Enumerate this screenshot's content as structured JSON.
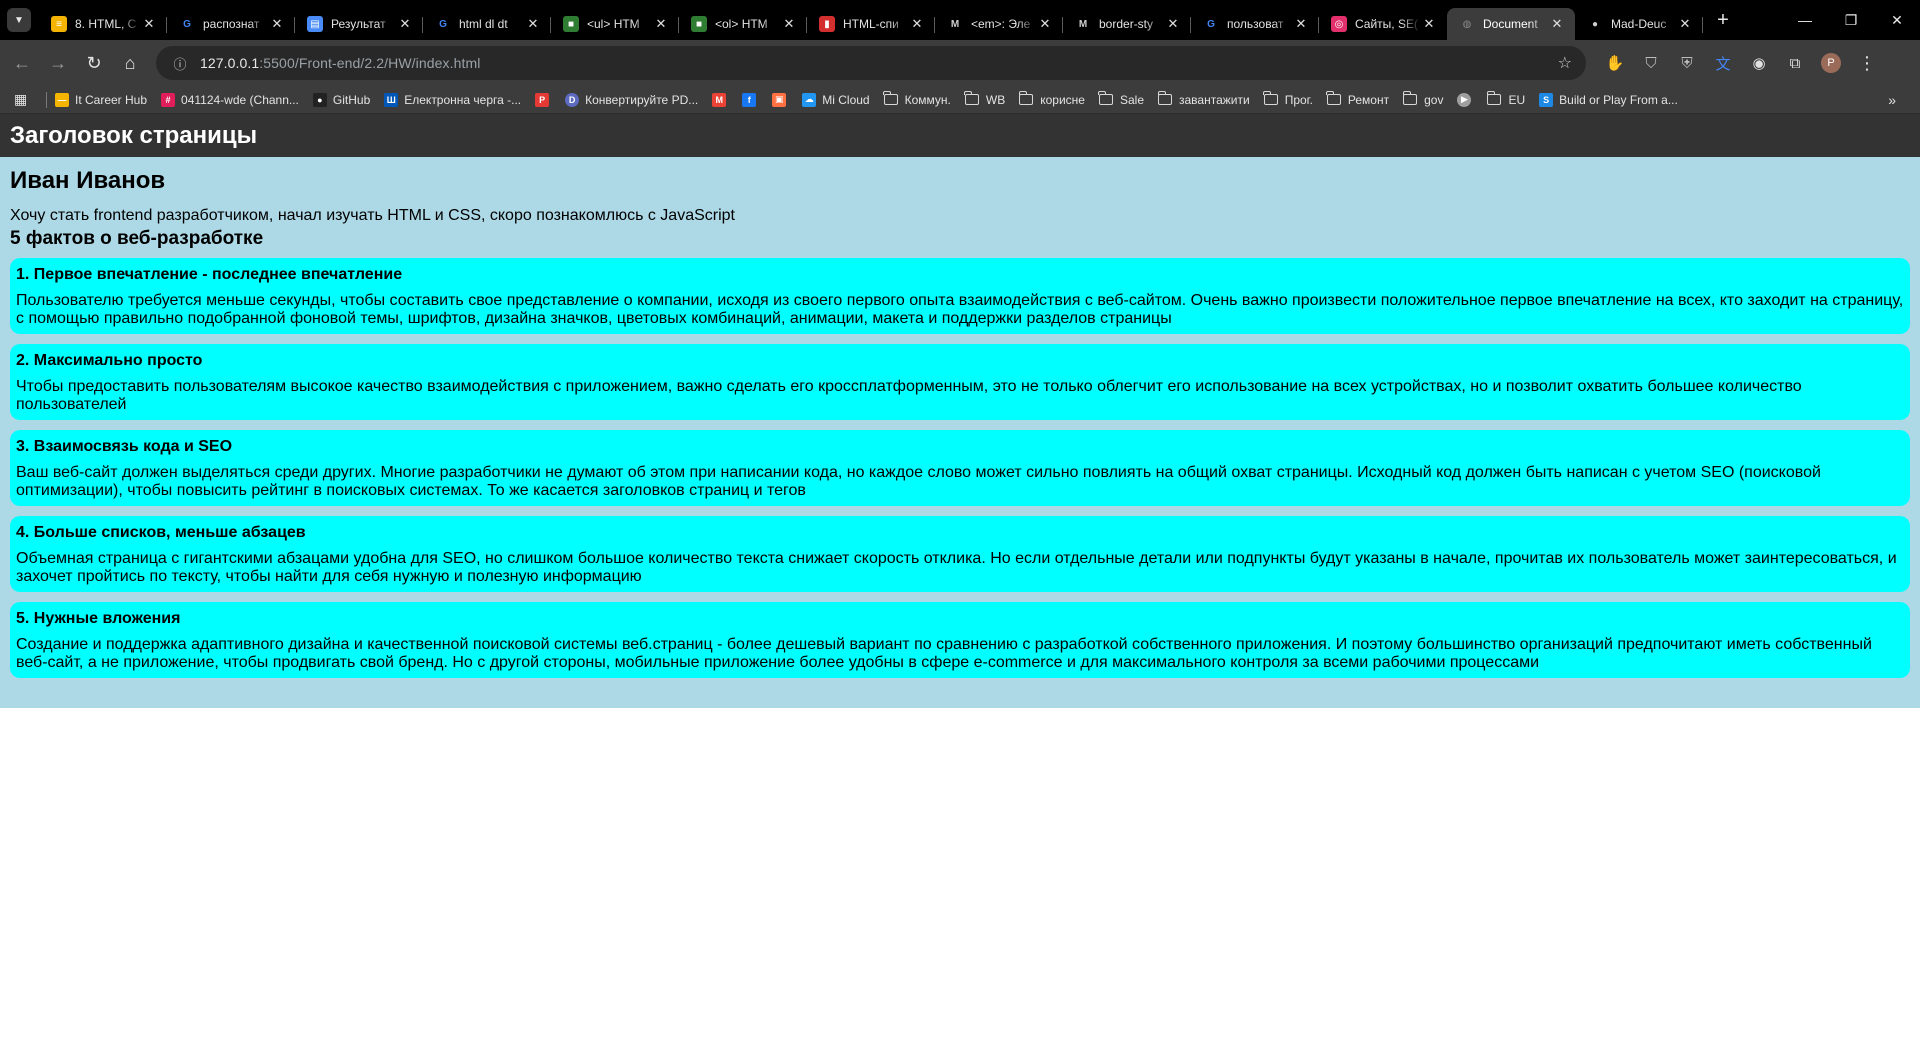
{
  "browser": {
    "tabs": [
      {
        "title": "8. HTML, С",
        "icon": "ui-lines-icon",
        "color": "#f4b400"
      },
      {
        "title": "распознат",
        "icon": "google-g-icon",
        "color": "#4285f4"
      },
      {
        "title": "Результат",
        "icon": "document-icon",
        "color": "#4a8cf7"
      },
      {
        "title": "html dl dt",
        "icon": "google-g-icon",
        "color": "#4285f4"
      },
      {
        "title": "<ul> HTM",
        "icon": "mdn-grid-icon",
        "color": "#2e7d32"
      },
      {
        "title": "<ol> HTM",
        "icon": "mdn-grid-icon",
        "color": "#2e7d32"
      },
      {
        "title": "HTML-спи",
        "icon": "chart-bars-icon",
        "color": "#d32f2f"
      },
      {
        "title": "<em>: Эле",
        "icon": "mdn-m-icon",
        "color": "#cfcfcf"
      },
      {
        "title": "border-sty",
        "icon": "mdn-m-icon",
        "color": "#cfcfcf"
      },
      {
        "title": "пользоват",
        "icon": "google-g-icon",
        "color": "#4285f4"
      },
      {
        "title": "Сайты, SE(",
        "icon": "instagram-icon",
        "color": "#e1306c"
      },
      {
        "title": "Document",
        "icon": "globe-icon",
        "color": "#8a8a8a"
      },
      {
        "title": "Mad-Deuc",
        "icon": "github-icon",
        "color": "#cfcfcf"
      }
    ],
    "active_tab_index": 11,
    "url_host": "127.0.0.1",
    "url_path": ":5500/Front-end/2.2/HW/index.html",
    "bookmarks": [
      {
        "label": "It Career Hub",
        "type": "link",
        "icon": "itcareer-icon",
        "color": "#f4b400"
      },
      {
        "label": "041124-wde (Chann...",
        "type": "link",
        "icon": "slack-icon",
        "color": "#e01e5a"
      },
      {
        "label": "GitHub",
        "type": "link",
        "icon": "github-icon",
        "color": "#222222"
      },
      {
        "label": "Електронна черга -...",
        "type": "link",
        "icon": "trident-icon",
        "color": "#0057b7"
      },
      {
        "label": "",
        "type": "icon",
        "icon": "pdf-icon",
        "color": "#e53935"
      },
      {
        "label": "Конвертируйте PD...",
        "type": "link",
        "icon": "d-circle-icon",
        "color": "#5c6bc0"
      },
      {
        "label": "",
        "type": "icon",
        "icon": "gmail-icon",
        "color": "#ea4335"
      },
      {
        "label": "",
        "type": "icon",
        "icon": "facebook-icon",
        "color": "#1877f2"
      },
      {
        "label": "",
        "type": "icon",
        "icon": "bookmark-app-icon",
        "color": "#ff7043"
      },
      {
        "label": "Mi Cloud",
        "type": "link",
        "icon": "cloud-icon",
        "color": "#2196f3"
      },
      {
        "label": "Коммун.",
        "type": "folder",
        "icon": "folder-icon"
      },
      {
        "label": "WB",
        "type": "folder",
        "icon": "folder-icon"
      },
      {
        "label": "корисне",
        "type": "folder",
        "icon": "folder-icon"
      },
      {
        "label": "Sale",
        "type": "folder",
        "icon": "folder-icon"
      },
      {
        "label": "завантажити",
        "type": "folder",
        "icon": "folder-icon"
      },
      {
        "label": "Прог.",
        "type": "folder",
        "icon": "folder-icon"
      },
      {
        "label": "Ремонт",
        "type": "folder",
        "icon": "folder-icon"
      },
      {
        "label": "gov",
        "type": "folder",
        "icon": "folder-icon"
      },
      {
        "label": "",
        "type": "icon",
        "icon": "play-circle-icon",
        "color": "#9e9e9e"
      },
      {
        "label": "EU",
        "type": "folder",
        "icon": "folder-icon"
      },
      {
        "label": "Build or Play From a...",
        "type": "link",
        "icon": "s-logo-icon",
        "color": "#1e88e5"
      }
    ],
    "extensions": [
      {
        "icon": "adblock-hand-icon",
        "color": "#e53935"
      },
      {
        "icon": "shield-icon",
        "color": "#bdbdbd"
      },
      {
        "icon": "shield-check-icon",
        "color": "#bdbdbd"
      },
      {
        "icon": "translate-icon",
        "color": "#4285f4"
      },
      {
        "icon": "screenshot-icon",
        "color": "#e0e0e0"
      },
      {
        "icon": "puzzle-icon",
        "color": "#e0e0e0"
      }
    ],
    "avatar_letter": "P"
  },
  "page": {
    "header_title": "Заголовок страницы",
    "name": "Иван Иванов",
    "intro": "Хочу стать frontend разработчиком, начал изучать HTML и CSS, скоро познакомлюсь с JavaScript",
    "facts_title": "5 фактов о веб-разработке",
    "facts": [
      {
        "title": "1. Первое впечатление - последнее впечатление",
        "text": "Пользователю требуется меньше секунды, чтобы составить свое представление о компании, исходя из своего первого опыта взаимодействия с веб-сайтом. Очень важно произвести положительное первое впечатление на всех, кто заходит на страницу, с помощью правильно подобранной фоновой темы, шрифтов, дизайна значков, цветовых комбинаций, анимации, макета и поддержки разделов страницы"
      },
      {
        "title": "2. Максимально просто",
        "text": "Чтобы предоставить пользователям высокое качество взаимодействия с приложением, важно сделать его кроссплатформенным, это не только облегчит его использование на всех устройствах, но и позволит охватить большее количество пользователей"
      },
      {
        "title": "3. Взаимосвязь кода и SEO",
        "text": "Ваш веб-сайт должен выделяться среди других. Многие разработчики не думают об этом при написании кода, но каждое слово может сильно повлиять на общий охват страницы. Исходный код должен быть написан с учетом SEO (поисковой оптимизации), чтобы повысить рейтинг в поисковых системах. То же касается заголовков страниц и тегов"
      },
      {
        "title": "4. Больше списков, меньше абзацев",
        "text": "Объемная страница с гигантскими абзацами удобна для SEO, но слишком большое количество текста снижает скорость отклика. Но если отдельные детали или подпункты будут указаны в начале, прочитав их пользователь может заинтересоваться, и захочет пройтись по тексту, чтобы найти для себя нужную и полезную информацию"
      },
      {
        "title": "5. Нужные вложения",
        "text": "Создание и поддержка адаптивного дизайна и качественной поисковой системы веб.страниц - более дешевый вариант по сравнению с разработкой собственного приложения. И поэтому большинство организаций предпочитают иметь собственный веб-сайт, а не приложение, чтобы продвигать свой бренд. Но с другой стороны, мобильные приложение более удобны в сфере e-commerce и для максимального контроля за всеми рабочими процессами"
      }
    ]
  }
}
